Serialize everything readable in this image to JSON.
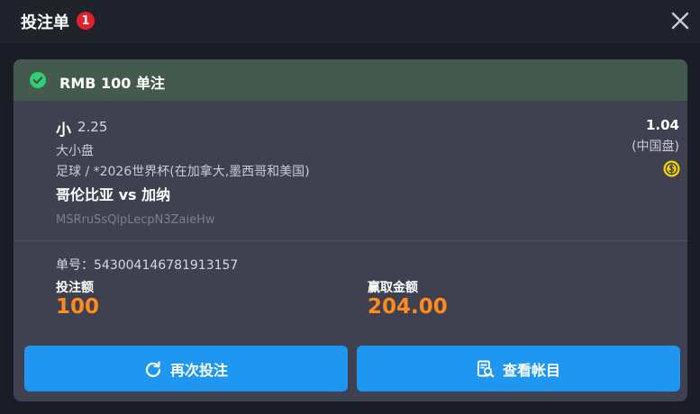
{
  "header": {
    "title": "投注单",
    "count": "1"
  },
  "bet": {
    "header": "RMB 100 单注",
    "selection": "小",
    "line": "2.25",
    "market": "大小盘",
    "league": "足球 / *2026世界杯(在加拿大,墨西哥和美国)",
    "match": "哥伦比亚 vs 加纳",
    "reference": "MSRruSsQlpLecpN3ZaieHw",
    "odds": "1.04",
    "odds_type": "(中国盘)",
    "bet_id": "单号：543004146781913157",
    "stake_label": "投注额",
    "stake_value": "100",
    "payout_label": "赢取金额",
    "payout_value": "204.00"
  },
  "actions": {
    "rebet_label": "再次投注",
    "account_label": "查看帐目"
  },
  "colors": {
    "accent": "#1f96ef",
    "amount": "#ff8a1f",
    "success": "#2fcf74",
    "badge": "#e5202e"
  }
}
